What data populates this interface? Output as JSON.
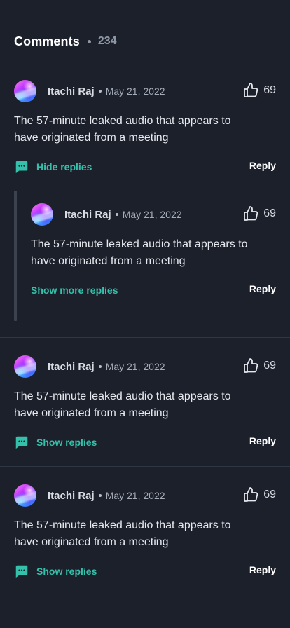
{
  "header": {
    "title": "Comments",
    "count": "234"
  },
  "comments": [
    {
      "author": "Itachi Raj",
      "date": "May 21, 2022",
      "likes": "69",
      "text": "The 57-minute leaked audio that appears to have originated from a meeting",
      "replies_toggle": "Hide replies",
      "reply_label": "Reply",
      "replies": [
        {
          "author": "Itachi Raj",
          "date": "May 21, 2022",
          "likes": "69",
          "text": "The 57-minute leaked audio that appears to have originated from a meeting",
          "more_replies": "Show more replies",
          "reply_label": "Reply"
        }
      ]
    },
    {
      "author": "Itachi Raj",
      "date": "May 21, 2022",
      "likes": "69",
      "text": "The 57-minute leaked audio that appears to have originated from a meeting",
      "replies_toggle": "Show replies",
      "reply_label": "Reply"
    },
    {
      "author": "Itachi Raj",
      "date": "May 21, 2022",
      "likes": "69",
      "text": "The 57-minute leaked audio that appears to have originated from a meeting",
      "replies_toggle": "Show replies",
      "reply_label": "Reply"
    }
  ],
  "icons": {
    "like": "thumbs-up-icon",
    "replies": "message-square-icon"
  },
  "colors": {
    "background": "#1b202b",
    "accent": "#34c0aa",
    "text": "#e7e9ee",
    "muted": "#a5acb8"
  }
}
